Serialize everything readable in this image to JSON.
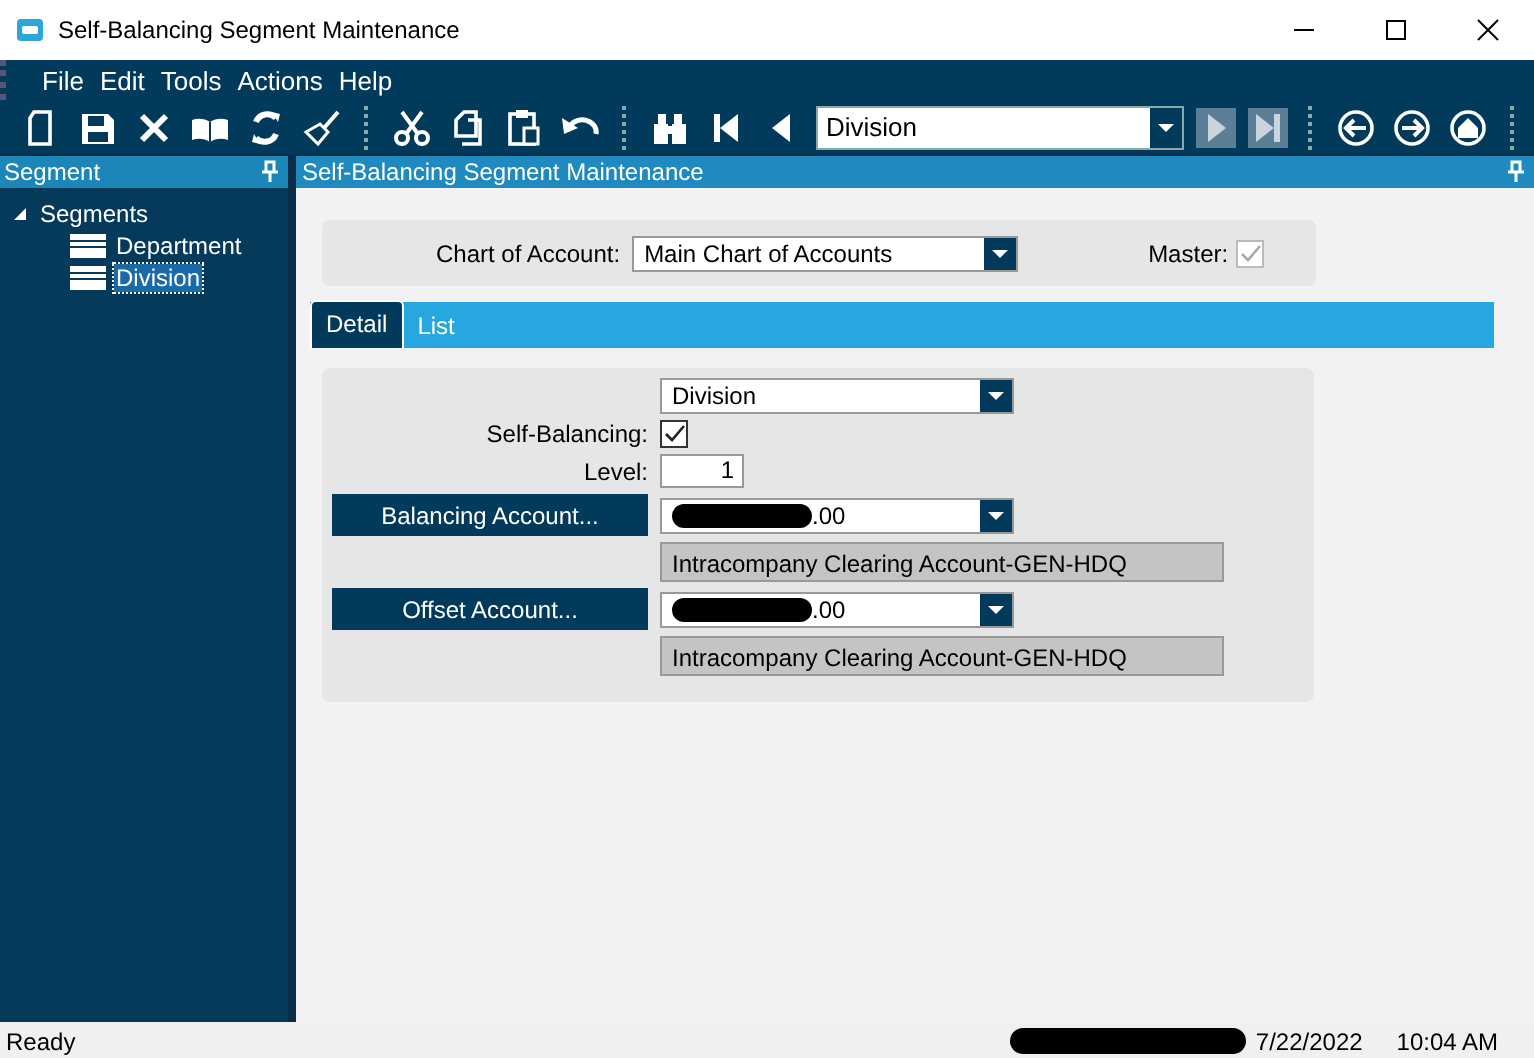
{
  "window": {
    "title": "Self-Balancing Segment Maintenance"
  },
  "menu": [
    "File",
    "Edit",
    "Tools",
    "Actions",
    "Help"
  ],
  "toolbar": [
    {
      "kind": "new",
      "disabled": false
    },
    {
      "kind": "save",
      "disabled": false
    },
    {
      "kind": "delete",
      "disabled": false
    },
    {
      "kind": "book",
      "disabled": false
    },
    {
      "kind": "refresh",
      "disabled": false
    },
    {
      "kind": "clear",
      "disabled": false
    },
    {
      "kind": "separator"
    },
    {
      "kind": "cut",
      "disabled": false
    },
    {
      "kind": "copy",
      "disabled": false
    },
    {
      "kind": "paste",
      "disabled": false
    },
    {
      "kind": "undo",
      "disabled": false
    },
    {
      "kind": "separator"
    },
    {
      "kind": "find",
      "disabled": false
    },
    {
      "kind": "first",
      "disabled": false
    },
    {
      "kind": "previous",
      "disabled": false
    },
    {
      "kind": "lookup",
      "value": "Division"
    },
    {
      "kind": "next",
      "disabled": true
    },
    {
      "kind": "last",
      "disabled": true
    },
    {
      "kind": "separator"
    },
    {
      "kind": "back",
      "disabled": false
    },
    {
      "kind": "forward",
      "disabled": false
    },
    {
      "kind": "home",
      "disabled": false
    },
    {
      "kind": "separator"
    }
  ],
  "sidebar": {
    "title": "Segment",
    "tree": [
      {
        "label": "Segments",
        "expanded": true,
        "children": [
          {
            "label": "Department",
            "selected": false
          },
          {
            "label": "Division",
            "selected": true
          }
        ]
      }
    ]
  },
  "main": {
    "title": "Self-Balancing Segment Maintenance",
    "chart_of_account": {
      "label": "Chart of Account:",
      "value": "Main Chart of Accounts"
    },
    "master": {
      "label": "Master:",
      "checked": true,
      "disabled": true
    },
    "tabs": [
      {
        "label": "Detail",
        "selected": true
      },
      {
        "label": "List",
        "selected": false
      }
    ],
    "detail": {
      "segment": {
        "value": "Division"
      },
      "self_balancing": {
        "label": "Self-Balancing:",
        "checked": true
      },
      "level": {
        "label": "Level:",
        "value": "1"
      },
      "accounts": [
        {
          "button": "Balancing Account...",
          "value": ".00",
          "redacted": true,
          "description": "Intracompany Clearing Account-GEN-HDQ"
        },
        {
          "button": "Offset Account...",
          "value": ".00",
          "redacted": true,
          "description": "Intracompany Clearing Account-GEN-HDQ"
        }
      ]
    }
  },
  "status_bar": {
    "text": "Ready",
    "redacted": true,
    "date": "7/22/2022",
    "time": "10:04 AM"
  }
}
